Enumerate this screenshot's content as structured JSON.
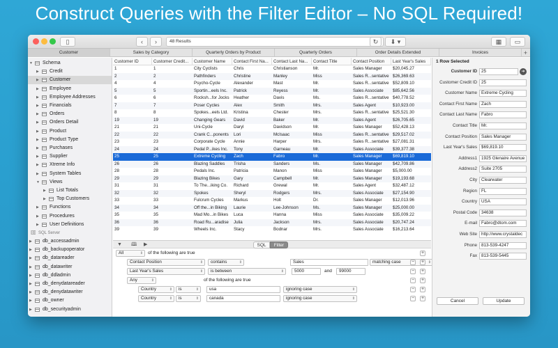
{
  "headline": "Construct Queries with the Filter Editor – No SQL Required!",
  "toolbar": {
    "results": "48 Results",
    "back": "‹",
    "forward": "›"
  },
  "tabs": [
    "Customer",
    "Sales by Category",
    "Quarterly Orders by Product",
    "Quarterly Orders",
    "Order Details Extended",
    "Invoices"
  ],
  "sidebar": {
    "schema_label": "Schema",
    "items": [
      "Credit",
      "Customer",
      "Employee",
      "Employee Addresses",
      "Financials",
      "Orders",
      "Orders Detail",
      "Product",
      "Product Type",
      "Purchases",
      "Supplier",
      "Xtreme Info",
      "System Tables"
    ],
    "views_label": "Views",
    "view_items": [
      "List Totals",
      "Top Customers"
    ],
    "more_items": [
      "Functions",
      "Procedures",
      "User Definitions"
    ],
    "server_label": "SQL Server",
    "db_items": [
      "db_accessadmin",
      "db_backupoperator",
      "db_datareader",
      "db_datawriter",
      "db_ddladmin",
      "db_denydatareader",
      "db_denydatawriter",
      "db_owner",
      "db_securityadmin"
    ]
  },
  "grid": {
    "columns": [
      "Customer ID",
      "Customer Credit...",
      "Customer Name",
      "Contact First Na...",
      "Contact Last Na...",
      "Contact Title",
      "Contact Position",
      "Last Year's Sales"
    ],
    "rows": [
      [
        "1",
        "1",
        "City Cyclists",
        "Chris",
        "Christianson",
        "Mr.",
        "Sales Manager",
        "$20,045.27"
      ],
      [
        "2",
        "2",
        "Pathfinders",
        "Christine",
        "Manley",
        "Miss",
        "Sales R...sentative",
        "$26,369.63"
      ],
      [
        "4",
        "4",
        "Psycho-Cycle",
        "Alexander",
        "Mast",
        "Mr.",
        "Sales R...sentative",
        "$52,809.10"
      ],
      [
        "5",
        "5",
        "Sportin...eels Inc.",
        "Patrick",
        "Reyess",
        "Mr.",
        "Sales Associate",
        "$85,642.56"
      ],
      [
        "6",
        "6",
        "Rocksh...for Jocks",
        "Heather",
        "Davis",
        "Ms.",
        "Sales R...sentative",
        "$40,778.52"
      ],
      [
        "7",
        "7",
        "Poser Cycles",
        "Alex",
        "Smith",
        "Mrs.",
        "Sales Agent",
        "$10,923.00"
      ],
      [
        "8",
        "8",
        "Spokes...eels Ltd.",
        "Kristina",
        "Chester",
        "Mrs.",
        "Sales R...sentative",
        "$25,521.30"
      ],
      [
        "19",
        "19",
        "Changing Gears",
        "David",
        "Baker",
        "Mr.",
        "Sales Agent",
        "$26,705.65"
      ],
      [
        "21",
        "21",
        "Uni-Cycle",
        "Daryl",
        "Davidson",
        "Mr.",
        "Sales Manager",
        "$52,428.13"
      ],
      [
        "22",
        "22",
        "Crank C...ponents",
        "Lori",
        "McIsaac",
        "Miss",
        "Sales R...sentative",
        "$29,517.02"
      ],
      [
        "23",
        "23",
        "Corporate Cycle",
        "Annie",
        "Harper",
        "Mrs.",
        "Sales R...sentative",
        "$27,081.31"
      ],
      [
        "24",
        "24",
        "Pedal P...ikes Inc.",
        "Tony",
        "Garneau",
        "Mr.",
        "Sales Associate",
        "$39,377.38"
      ],
      [
        "25",
        "25",
        "Extreme Cycling",
        "Zach",
        "Fabro",
        "Mr.",
        "Sales Manager",
        "$69,819.10"
      ],
      [
        "26",
        "26",
        "Blazing Saddles",
        "Trisha",
        "Sanders",
        "Ms.",
        "Sales Manager",
        "$42,709.86"
      ],
      [
        "28",
        "28",
        "Pedals Inc.",
        "Patricia",
        "Manon",
        "Miss",
        "Sales Manager",
        "$5,000.00"
      ],
      [
        "29",
        "29",
        "Blazing Bikes",
        "Gary",
        "Campbell",
        "Mr.",
        "Sales Manager",
        "$19,193.68"
      ],
      [
        "31",
        "31",
        "To The...iking Co.",
        "Richard",
        "Grewal",
        "Mr.",
        "Sales Agent",
        "$32,487.12"
      ],
      [
        "32",
        "32",
        "Spokes",
        "Sheryl",
        "Rodgers",
        "Mrs.",
        "Sales Associate",
        "$27,154.90"
      ],
      [
        "33",
        "33",
        "Fulcrum Cycles",
        "Markus",
        "Holt",
        "Dr.",
        "Sales Manager",
        "$12,013.96"
      ],
      [
        "34",
        "34",
        "Off the...in Biking",
        "Laurie",
        "Lee-Johnson",
        "Ms.",
        "Sales Manager",
        "$25,000.00"
      ],
      [
        "35",
        "35",
        "Mad Mo...in Bikes",
        "Luca",
        "Hanna",
        "Miss",
        "Sales Associate",
        "$35,009.22"
      ],
      [
        "36",
        "36",
        "Road Ru...aradise",
        "Julia",
        "Jackson",
        "Mrs.",
        "Sales Associate",
        "$20,747.24"
      ],
      [
        "39",
        "39",
        "Wheels Inc.",
        "Stacy",
        "Bodnar",
        "Mrs.",
        "Sales Associate",
        "$16,213.64"
      ]
    ],
    "selected_index": 12
  },
  "filter_toolbar": {
    "sql_label": "SQL",
    "filter_label": "Filter"
  },
  "filter": {
    "root": {
      "quantifier": "All",
      "suffix": "of the following are true"
    },
    "rule1": {
      "field": "Contact Position",
      "op": "contains",
      "value": "Sales",
      "option": "matching case"
    },
    "rule2": {
      "field": "Last Year's Sales",
      "op": "is between",
      "value1": "5000",
      "and": "and",
      "value2": "99000"
    },
    "group": {
      "quantifier": "Any",
      "suffix": "of the following are true"
    },
    "rule3": {
      "field": "Country",
      "op": "is",
      "value": "usa",
      "option": "ignoring case"
    },
    "rule4": {
      "field": "Country",
      "op": "is",
      "value": "canada",
      "option": "ignoring case"
    }
  },
  "detail": {
    "title": "1 Row Selected",
    "fields": [
      {
        "label": "Customer ID",
        "value": "25"
      },
      {
        "label": "Customer Credit ID",
        "value": "25"
      },
      {
        "label": "Customer Name",
        "value": "Extreme Cycling"
      },
      {
        "label": "Contact First Name",
        "value": "Zach"
      },
      {
        "label": "Contact Last Name",
        "value": "Fabro"
      },
      {
        "label": "Contact Title",
        "value": "Mr."
      },
      {
        "label": "Contact Position",
        "value": "Sales Manager"
      },
      {
        "label": "Last Year's Sales",
        "value": "$69,819.10"
      },
      {
        "label": "Address1",
        "value": "1925 Glenaire Avenue"
      },
      {
        "label": "Address2",
        "value": "Suite 2705"
      },
      {
        "label": "City",
        "value": "Clearwater"
      },
      {
        "label": "Region",
        "value": "FL"
      },
      {
        "label": "Country",
        "value": "USA"
      },
      {
        "label": "Postal Code",
        "value": "34638"
      },
      {
        "label": "E-mail",
        "value": "Fabro@dtom.com"
      },
      {
        "label": "Web Site",
        "value": "http://www.crystaldec"
      },
      {
        "label": "Phone",
        "value": "813-539-4247"
      },
      {
        "label": "Fax",
        "value": "813-539-5445"
      }
    ],
    "cancel_label": "Cancel",
    "update_label": "Update"
  },
  "colors": {
    "background": "#2a9fcf",
    "selection": "#1a6ad8"
  }
}
